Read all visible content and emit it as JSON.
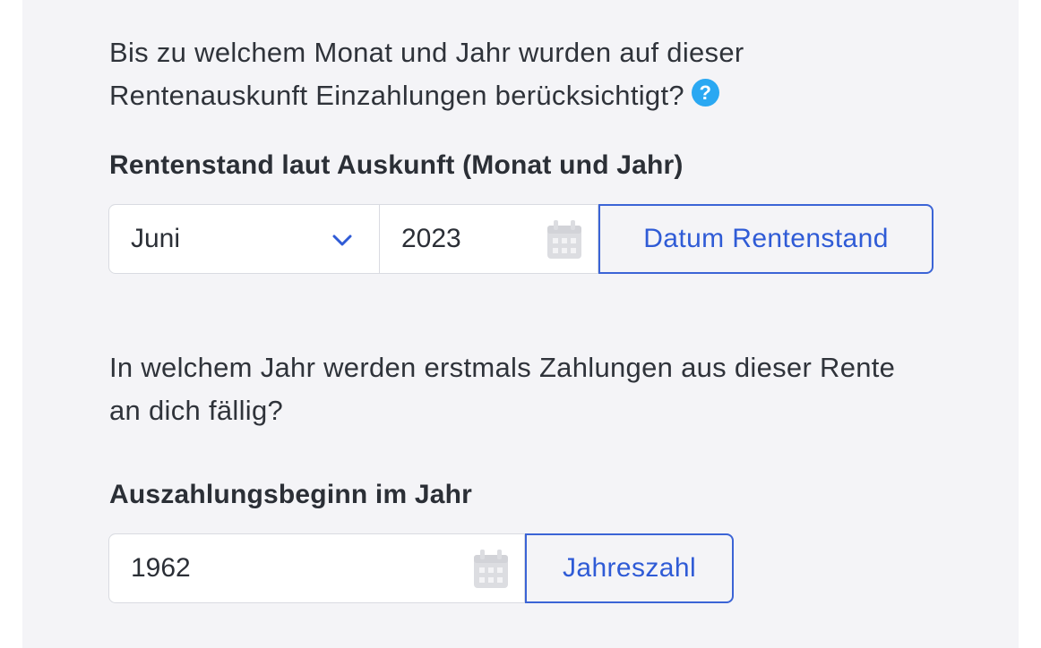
{
  "section_pension_status": {
    "question": "Bis zu welchem Monat und Jahr wurden auf dieser Rentenauskunft Einzahlungen berücksichtigt?",
    "help_icon": "?",
    "label": "Rentenstand laut Auskunft (Monat und Jahr)",
    "month_select_value": "Juni",
    "year_value": "2023",
    "addon_button": "Datum Rentenstand"
  },
  "section_payout_start": {
    "question": "In welchem Jahr werden erstmals Zahlungen aus dieser Rente an dich fällig?",
    "label": "Auszahlungsbeginn im Jahr",
    "year_value": "1962",
    "addon_button": "Jahreszahl"
  },
  "icons": {
    "help": "question-circle-icon",
    "chevron": "chevron-down-icon",
    "calendar": "calendar-icon"
  },
  "colors": {
    "accent": "#2f5bd6",
    "help_icon": "#2aa8f2",
    "panel_background": "#f4f4f7"
  }
}
